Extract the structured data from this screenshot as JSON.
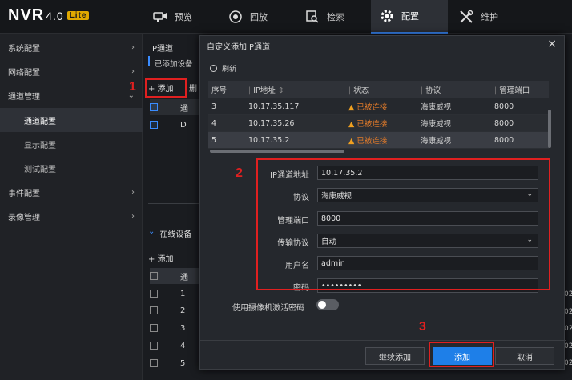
{
  "app": {
    "brand": "NVR",
    "version": "4.0",
    "edition": "Lite"
  },
  "nav": [
    {
      "label": "预览",
      "icon": "camera-icon"
    },
    {
      "label": "回放",
      "icon": "playback-icon"
    },
    {
      "label": "检索",
      "icon": "search-icon"
    },
    {
      "label": "配置",
      "icon": "gear-icon",
      "active": true
    },
    {
      "label": "维护",
      "icon": "tools-icon"
    }
  ],
  "sidebar": [
    {
      "label": "系统配置"
    },
    {
      "label": "网络配置"
    },
    {
      "label": "通道管理"
    },
    {
      "label": "通道配置"
    },
    {
      "label": "显示配置"
    },
    {
      "label": "测试配置"
    },
    {
      "label": "事件配置"
    },
    {
      "label": "录像管理"
    }
  ],
  "background": {
    "tab": "IP通道",
    "added_label": "已添加设备",
    "add_button": "+ 添加",
    "delete_button": "删",
    "online_section": "在线设备",
    "online_add": "+ 添加",
    "upper_rows": [
      "通",
      "D"
    ],
    "lower_header": "通",
    "lower_rows": [
      "1",
      "2",
      "3",
      "4",
      "5"
    ],
    "right_edge": [
      "02",
      "02",
      "02",
      "02",
      "02"
    ]
  },
  "dialog": {
    "title": "自定义添加IP通道",
    "close": "×",
    "refresh": "刷新",
    "columns": [
      "序号",
      "IP地址",
      "状态",
      "协议",
      "管理端口"
    ],
    "rows": [
      {
        "no": "3",
        "ip": "10.17.35.117",
        "status": "已被连接",
        "protocol": "海康威视",
        "port": "8000"
      },
      {
        "no": "4",
        "ip": "10.17.35.26",
        "status": "已被连接",
        "protocol": "海康威视",
        "port": "8000"
      },
      {
        "no": "5",
        "ip": "10.17.35.2",
        "status": "已被连接",
        "protocol": "海康威视",
        "port": "8000"
      }
    ],
    "form": {
      "ip_label": "IP通道地址",
      "ip_value": "10.17.35.2",
      "protocol_label": "协议",
      "protocol_value": "海康威视",
      "port_label": "管理端口",
      "port_value": "8000",
      "transport_label": "传输协议",
      "transport_value": "自动",
      "user_label": "用户名",
      "user_value": "admin",
      "pwd_label": "密码",
      "pwd_value": "•••••••••"
    },
    "toggle_label": "使用摄像机激活密码",
    "buttons": {
      "continue": "继续添加",
      "add": "添加",
      "cancel": "取消"
    }
  },
  "annotations": [
    "1",
    "2",
    "3"
  ]
}
